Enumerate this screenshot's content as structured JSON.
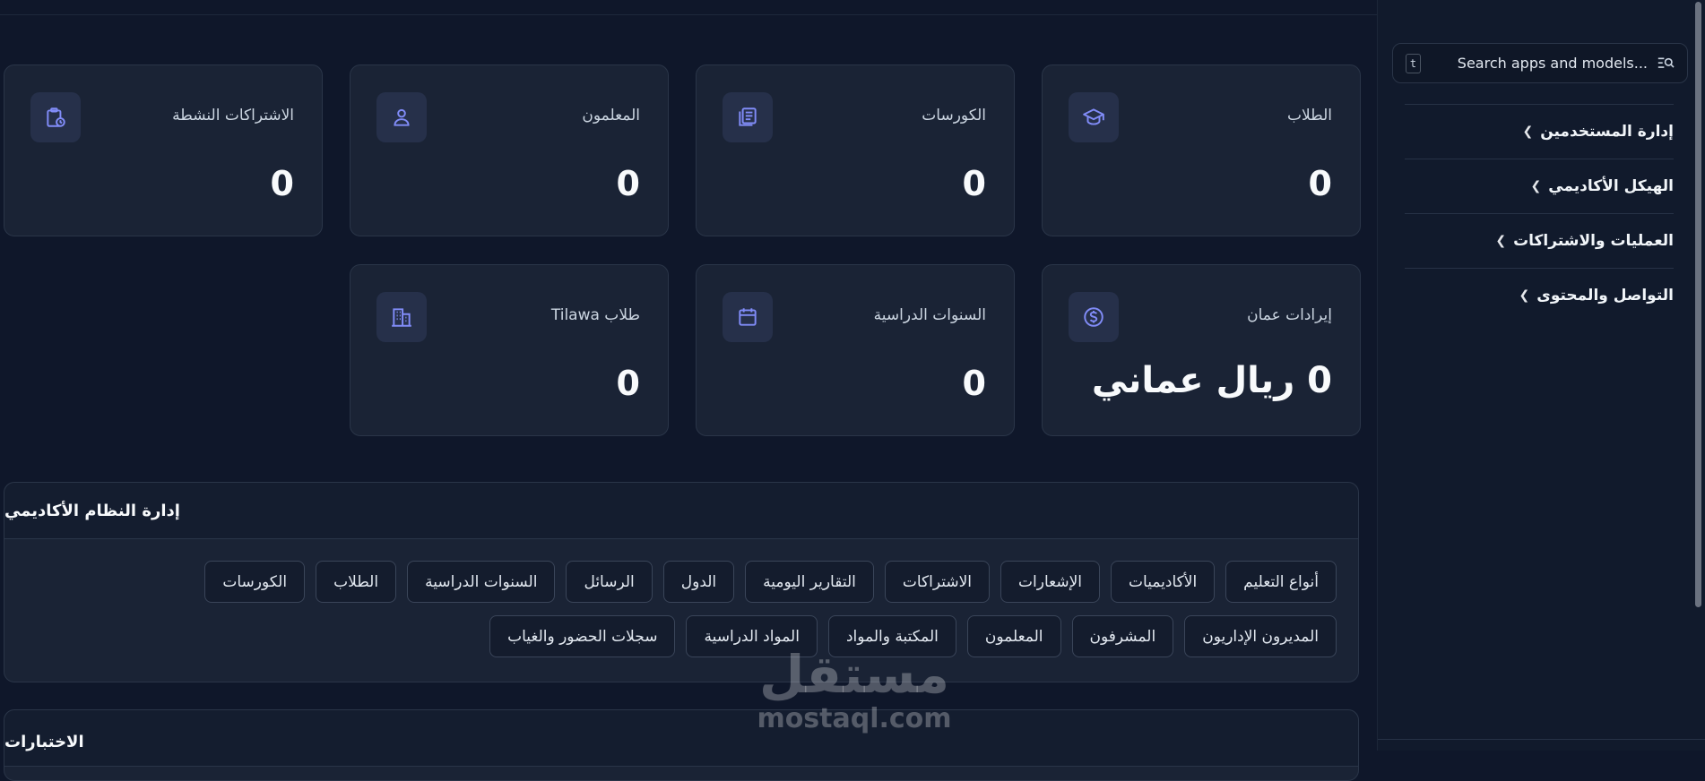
{
  "sidebar": {
    "search": {
      "placeholder": "Search apps and models...",
      "shortcut": "t"
    },
    "items": [
      {
        "label": "إدارة المستخدمين"
      },
      {
        "label": "الهيكل الأكاديمي"
      },
      {
        "label": "العمليات والاشتراكات"
      },
      {
        "label": "التواصل والمحتوى"
      }
    ]
  },
  "stats": {
    "students": {
      "label": "الطلاب",
      "value": "0",
      "icon": "graduation-cap-icon"
    },
    "courses": {
      "label": "الكورسات",
      "value": "0",
      "icon": "documents-icon"
    },
    "teachers": {
      "label": "المعلمون",
      "value": "0",
      "icon": "user-icon"
    },
    "active_subscriptions": {
      "label": "الاشتراكات النشطة",
      "value": "0",
      "icon": "clipboard-clock-icon"
    },
    "oman_revenue": {
      "label": "إيرادات عمان",
      "value": "0 ريال عماني",
      "icon": "dollar-circle-icon"
    },
    "academic_years": {
      "label": "السنوات الدراسية",
      "value": "0",
      "icon": "calendar-icon"
    },
    "tilawa_students": {
      "label": "طلاب Tilawa",
      "value": "0",
      "icon": "building-icon"
    }
  },
  "academic_panel": {
    "title": "إدارة النظام الأكاديمي",
    "row1": [
      "أنواع التعليم",
      "الأكاديميات",
      "الإشعارات",
      "الاشتراكات",
      "التقارير اليومية",
      "الدول",
      "الرسائل",
      "السنوات الدراسية",
      "الطلاب",
      "الكورسات"
    ],
    "row2": [
      "المديرون الإداريون",
      "المشرفون",
      "المعلمون",
      "المكتبة والمواد",
      "المواد الدراسية",
      "سجلات الحضور والغياب"
    ]
  },
  "exams_panel": {
    "title": "الاختبارات"
  },
  "watermark": {
    "arabic": "مستقل",
    "latin": "mostaql.com"
  },
  "colors": {
    "accent": "#818cf8",
    "background": "#0f172a",
    "card": "#1a2335"
  }
}
